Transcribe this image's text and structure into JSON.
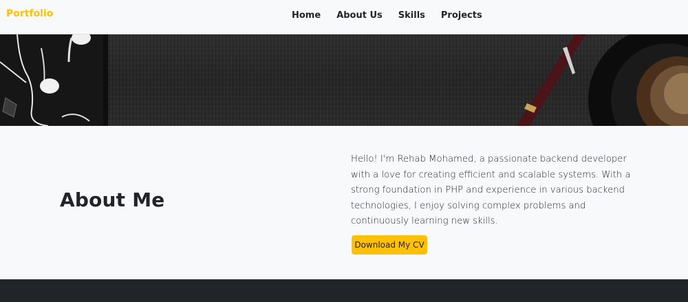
{
  "navbar": {
    "brand": "Portfolio",
    "links": [
      "Home",
      "About Us",
      "Skills",
      "Projects"
    ]
  },
  "about": {
    "title": "About Me",
    "text": "Hello! I'm Rehab Mohamed, a passionate backend developer with a love for creating efficient and scalable systems. With a strong foundation in PHP and experience in various backend technologies, I enjoy solving complex problems and continuously learning new skills.",
    "button_label": "Download My CV"
  },
  "colors": {
    "accent": "#ffc107",
    "navbar_bg": "#f8f9fa",
    "footer_bg": "#212529"
  }
}
